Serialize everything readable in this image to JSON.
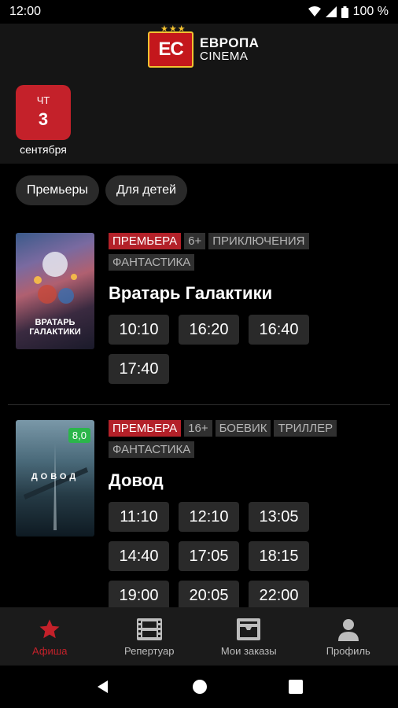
{
  "status": {
    "time": "12:00",
    "battery": "100 %"
  },
  "logo": {
    "letters": "ЕС",
    "line1": "ЕВРОПА",
    "line2": "CINEMA"
  },
  "date": {
    "dow": "ЧТ",
    "day": "3",
    "month": "сентября"
  },
  "filters": [
    "Премьеры",
    "Для детей"
  ],
  "movies": [
    {
      "tags": [
        "ПРЕМЬЕРА",
        "6+",
        "ПРИКЛЮЧЕНИЯ",
        "ФАНТАСТИКА"
      ],
      "title": "Вратарь Галактики",
      "poster_text": "ВРАТАРЬ ГАЛАКТИКИ",
      "times": [
        "10:10",
        "16:20",
        "16:40",
        "17:40"
      ]
    },
    {
      "tags": [
        "ПРЕМЬЕРА",
        "16+",
        "БОЕВИК",
        "ТРИЛЛЕР",
        "ФАНТАСТИКА"
      ],
      "title": "Довод",
      "rating": "8,0",
      "poster_text": "ДОВОД",
      "times": [
        "11:10",
        "12:10",
        "13:05",
        "14:40",
        "17:05",
        "18:15",
        "19:00",
        "20:05",
        "22:00"
      ]
    }
  ],
  "nav": [
    "Афиша",
    "Репертуар",
    "Мои заказы",
    "Профиль"
  ],
  "colors": {
    "accent": "#c4212a",
    "rating": "#2bb64a"
  }
}
